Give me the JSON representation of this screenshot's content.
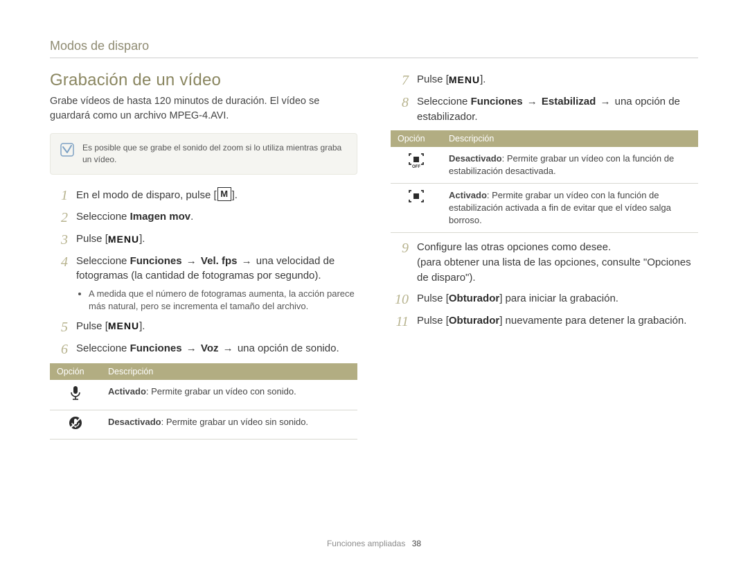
{
  "section_label": "Modos de disparo",
  "title": "Grabación de un vídeo",
  "intro": "Grabe vídeos de hasta 120 minutos de duración. El vídeo se guardará como un archivo MPEG-4.AVI.",
  "note": "Es posible que se grabe el sonido del zoom si lo utiliza mientras graba un vídeo.",
  "steps_left": {
    "s1_a": "En el modo de disparo, pulse [",
    "s1_b": "].",
    "mode_icon": "M",
    "s2_a": "Seleccione ",
    "s2_b": "Imagen mov",
    "s2_c": ".",
    "s3_a": "Pulse [",
    "s3_b": "].",
    "menu": "MENU",
    "s4_a": "Seleccione ",
    "s4_b": "Funciones",
    "s4_arrow1": "→",
    "s4_c": "Vel. fps",
    "s4_arrow2": "→",
    "s4_d": " una velocidad de fotogramas (la cantidad de fotogramas por segundo).",
    "s4_bullet": "A medida que el número de fotogramas aumenta, la acción parece más natural, pero se incrementa el tamaño del archivo.",
    "s5_a": "Pulse [",
    "s5_b": "].",
    "s6_a": "Seleccione ",
    "s6_b": "Funciones",
    "s6_arrow1": "→",
    "s6_c": "Voz",
    "s6_arrow2": "→",
    "s6_d": " una opción de sonido."
  },
  "table1": {
    "h_opt": "Opción",
    "h_desc": "Descripción",
    "r1_icon": "mic",
    "r1_b": "Activado",
    "r1_t": ": Permite grabar un vídeo con sonido.",
    "r2_icon": "mute",
    "r2_b": "Desactivado",
    "r2_t": ": Permite grabar un vídeo sin sonido."
  },
  "steps_right": {
    "n7": "7",
    "s7_a": "Pulse [",
    "s7_b": "].",
    "menu": "MENU",
    "n8": "8",
    "s8_a": "Seleccione ",
    "s8_b": "Funciones",
    "s8_arrow1": "→",
    "s8_c": "Estabilizad",
    "s8_arrow2": "→",
    "s8_d": " una opción de estabilizador."
  },
  "table2": {
    "h_opt": "Opción",
    "h_desc": "Descripción",
    "r1_icon": "stab-off",
    "r1_b": "Desactivado",
    "r1_t": ": Permite grabar un vídeo con la función de estabilización desactivada.",
    "r2_icon": "stab-on",
    "r2_b": "Activado",
    "r2_t": ": Permite grabar un vídeo con la función de estabilización activada a fin de evitar que el vídeo salga borroso."
  },
  "steps_right2": {
    "n9": "9",
    "s9": "Configure las otras opciones como desee.",
    "s9_sub": "(para obtener una lista de las opciones, consulte \"Opciones de disparo\").",
    "n10": "10",
    "s10_a": "Pulse [",
    "s10_b": "Obturador",
    "s10_c": "] para iniciar la grabación.",
    "n11": "11",
    "s11_a": "Pulse [",
    "s11_b": "Obturador",
    "s11_c": "] nuevamente para detener la grabación."
  },
  "footer": {
    "label": "Funciones ampliadas",
    "page": "38"
  }
}
